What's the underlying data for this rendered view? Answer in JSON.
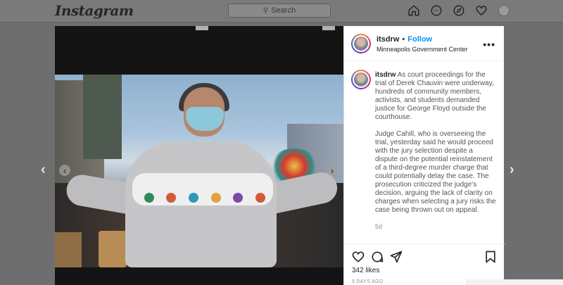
{
  "app": {
    "logo": "Instagram",
    "search_placeholder": "Search",
    "nav_icons": [
      "home-icon",
      "messenger-icon",
      "explore-icon",
      "heart-icon",
      "profile-avatar"
    ]
  },
  "post": {
    "username": "itsdrw",
    "separator": "•",
    "follow_label": "Follow",
    "location": "Minneapolis Government Center",
    "more_label": "•••",
    "caption_paragraphs": [
      "As court proceedings for the trial of Derek Chauvin were underway, hundreds of community members, activists, and students demanded justice for George Floyd outside the courthouse.",
      "Judge Cahill, who is overseeing the trial, yesterday said he would proceed with the jury selection despite a dispute on the potential reinstatement of a third-degree murder charge that could potentially delay the case. The prosecution criticized the judge's decision, arguing the lack of clarity on charges when selecting a jury risks the case being thrown out on appeal."
    ],
    "caption_age": "5d",
    "likes": "342 likes",
    "posted": "5 DAYS AGO"
  },
  "carousel": {
    "prev_glyph": "‹",
    "next_glyph": "›"
  },
  "page_nav": {
    "prev_glyph": "‹",
    "next_glyph": "›"
  },
  "colors": {
    "accent": "#0095f6",
    "overlay": "#6e6e6e",
    "panel_bg": "#ffffff"
  }
}
